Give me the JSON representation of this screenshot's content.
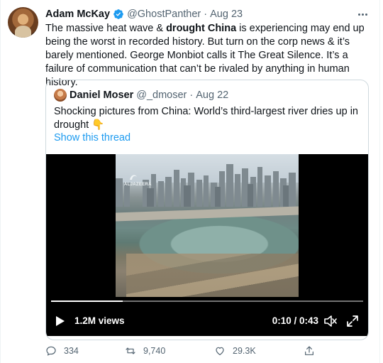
{
  "tweet": {
    "author_name": "Adam McKay",
    "handle": "@GhostPanther",
    "separator": "·",
    "date": "Aug 23",
    "text_part1": "The massive heat wave & ",
    "text_bold": "drought China",
    "text_part2": " is experiencing may end up being the worst in recorded history. But turn on the corp news & it’s barely mentioned. George Monbiot calls it The Great Silence. It’s a failure of communication that can’t be rivaled by anything in human history.",
    "more_icon": "more-horizontal-icon",
    "verified_color": "#1d9bf0"
  },
  "quote": {
    "author_name": "Daniel Moser",
    "handle": "@_dmoser",
    "separator": "·",
    "date": "Aug 22",
    "text": "Shocking pictures from China: World’s third-largest river dries up in drought",
    "emoji": "👇",
    "thread_link": "Show this thread"
  },
  "video": {
    "watermark": "ALJAZEERA",
    "views": "1.2M views",
    "time": "0:10 / 0:43",
    "progress": 0.23
  },
  "actions": {
    "reply_count": "334",
    "retweet_count": "9,740",
    "like_count": "29.3K"
  },
  "colors": {
    "text": "#0f1419",
    "secondary": "#536471",
    "link": "#1d9bf0",
    "border": "#cfd9de"
  }
}
